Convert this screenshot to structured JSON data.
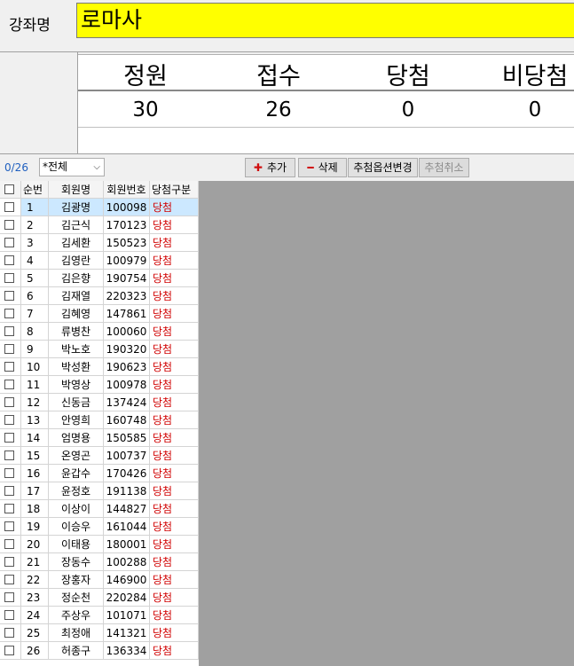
{
  "course": {
    "label": "강좌명",
    "value": "로마사"
  },
  "stats": {
    "headers": [
      "정원",
      "접수",
      "당첨",
      "비당첨"
    ],
    "values": [
      "30",
      "26",
      "0",
      "0"
    ]
  },
  "toolbar": {
    "count": "0/26",
    "filter_value": "*전체",
    "add_label": "추가",
    "delete_label": "삭제",
    "option_label": "추첨옵션변경",
    "cancel_label": "추첨취소"
  },
  "grid": {
    "columns": [
      "순번",
      "회원명",
      "회원번호",
      "당첨구분"
    ],
    "rows": [
      [
        "1",
        "김광명",
        "100098",
        "당첨"
      ],
      [
        "2",
        "김근식",
        "170123",
        "당첨"
      ],
      [
        "3",
        "김세환",
        "150523",
        "당첨"
      ],
      [
        "4",
        "김영란",
        "100979",
        "당첨"
      ],
      [
        "5",
        "김은향",
        "190754",
        "당첨"
      ],
      [
        "6",
        "김재열",
        "220323",
        "당첨"
      ],
      [
        "7",
        "김혜영",
        "147861",
        "당첨"
      ],
      [
        "8",
        "류병찬",
        "100060",
        "당첨"
      ],
      [
        "9",
        "박노호",
        "190320",
        "당첨"
      ],
      [
        "10",
        "박성환",
        "190623",
        "당첨"
      ],
      [
        "11",
        "박영상",
        "100978",
        "당첨"
      ],
      [
        "12",
        "신동금",
        "137424",
        "당첨"
      ],
      [
        "13",
        "안영희",
        "160748",
        "당첨"
      ],
      [
        "14",
        "엄명용",
        "150585",
        "당첨"
      ],
      [
        "15",
        "온영곤",
        "100737",
        "당첨"
      ],
      [
        "16",
        "윤갑수",
        "170426",
        "당첨"
      ],
      [
        "17",
        "윤정호",
        "191138",
        "당첨"
      ],
      [
        "18",
        "이상이",
        "144827",
        "당첨"
      ],
      [
        "19",
        "이승우",
        "161044",
        "당첨"
      ],
      [
        "20",
        "이태용",
        "180001",
        "당첨"
      ],
      [
        "21",
        "장동수",
        "100288",
        "당첨"
      ],
      [
        "22",
        "장홍자",
        "146900",
        "당첨"
      ],
      [
        "23",
        "정순천",
        "220284",
        "당첨"
      ],
      [
        "24",
        "주상우",
        "101071",
        "당첨"
      ],
      [
        "25",
        "최정애",
        "141321",
        "당첨"
      ],
      [
        "26",
        "허종구",
        "136334",
        "당첨"
      ]
    ]
  },
  "colors": {
    "highlight": "#ffff00",
    "winner": "#d00000",
    "selected_row": "#cce8ff"
  }
}
